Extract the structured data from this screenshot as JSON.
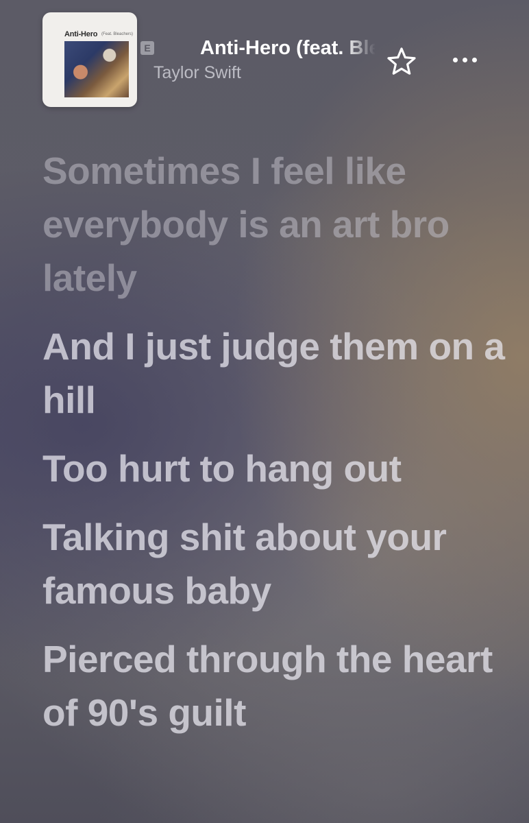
{
  "header": {
    "artwork": {
      "title": "Anti-Hero",
      "subtitle": "(Feat. Bleachers)"
    },
    "explicit_badge": "E",
    "song_title": "Anti-Hero (feat. Bleachers)",
    "artist": "Taylor Swift",
    "star_icon": "star-outline-icon",
    "more_icon": "ellipsis-icon"
  },
  "lyrics": [
    "Sometimes I feel like everybody is an art bro lately",
    "And I just judge them on a hill",
    "Too hurt to hang out",
    "Talking shit about your famous baby",
    "Pierced through the heart of 90's guilt"
  ],
  "colors": {
    "background": "#5a5963",
    "title": "#ffffff",
    "artist": "#c9c8d2",
    "lyric": "#e6e4ec"
  }
}
